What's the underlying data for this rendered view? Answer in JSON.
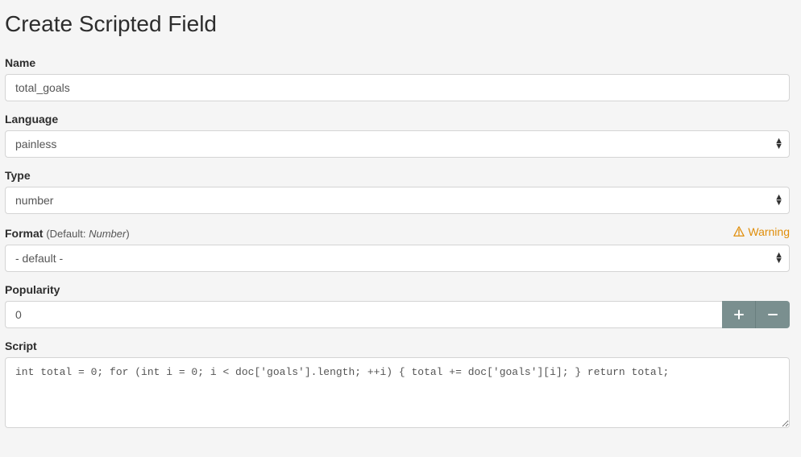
{
  "page": {
    "title": "Create Scripted Field"
  },
  "fields": {
    "name": {
      "label": "Name",
      "value": "total_goals"
    },
    "language": {
      "label": "Language",
      "value": "painless"
    },
    "type": {
      "label": "Type",
      "value": "number"
    },
    "format": {
      "label": "Format",
      "suffix_prefix": "(Default: ",
      "suffix_value": "Number",
      "suffix_postfix": ")",
      "value": "- default -",
      "warning": "Warning"
    },
    "popularity": {
      "label": "Popularity",
      "value": "0"
    },
    "script": {
      "label": "Script",
      "value": "int total = 0; for (int i = 0; i < doc['goals'].length; ++i) { total += doc['goals'][i]; } return total;"
    }
  }
}
